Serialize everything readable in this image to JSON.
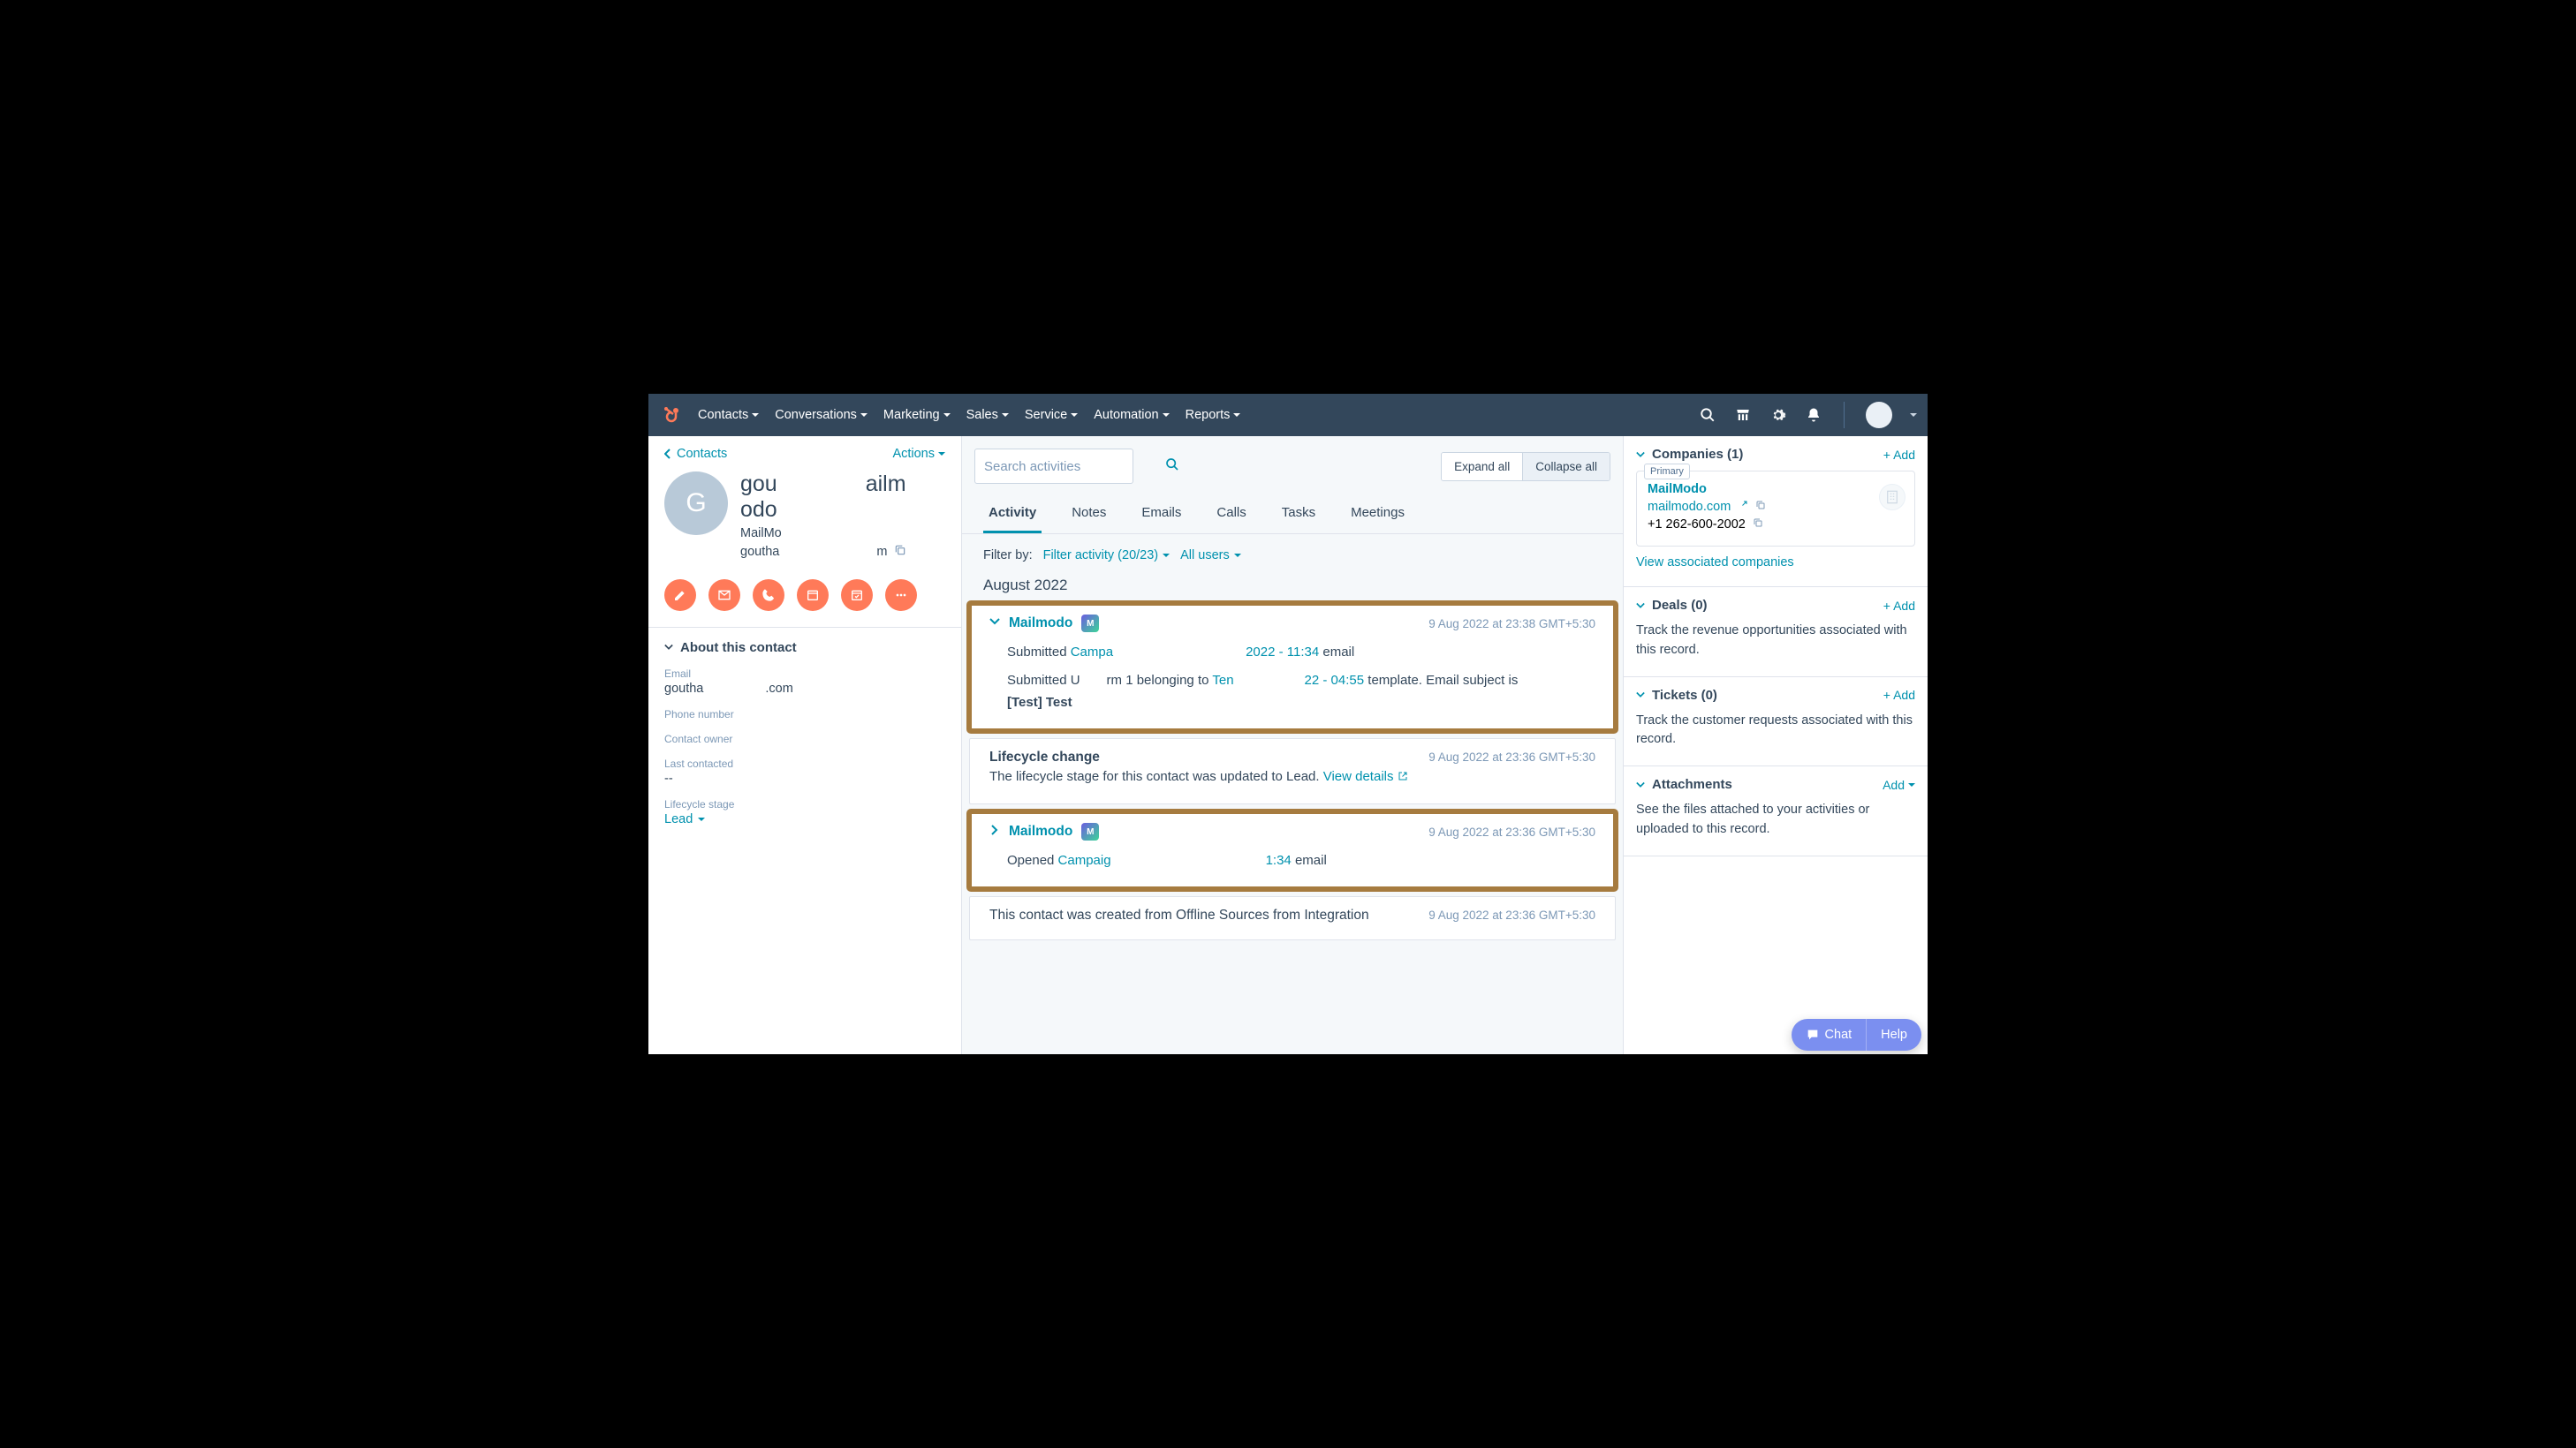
{
  "nav": {
    "items": [
      "Contacts",
      "Conversations",
      "Marketing",
      "Sales",
      "Service",
      "Automation",
      "Reports"
    ]
  },
  "left": {
    "back": "Contacts",
    "actions": "Actions",
    "avatar_letter": "G",
    "name_l1": "gou",
    "name_l2": "ailm",
    "name_l3": "odo",
    "company": "MailMo",
    "email_short_l": "goutha",
    "email_short_r": "m",
    "about_title": "About this contact",
    "fields": {
      "email_label": "Email",
      "email_value_l": "goutha",
      "email_value_r": ".com",
      "phone_label": "Phone number",
      "phone_value": "",
      "owner_label": "Contact owner",
      "owner_value": "",
      "last_label": "Last contacted",
      "last_value": "--",
      "stage_label": "Lifecycle stage",
      "stage_value": "Lead"
    }
  },
  "center": {
    "search_placeholder": "Search activities",
    "expand": "Expand all",
    "collapse": "Collapse all",
    "tabs": [
      "Activity",
      "Notes",
      "Emails",
      "Calls",
      "Tasks",
      "Meetings"
    ],
    "filter_by": "Filter by:",
    "filter_activity": "Filter activity (20/23)",
    "filter_users": "All users",
    "month": "August 2022",
    "card1": {
      "source": "Mailmodo",
      "date": "9 Aug 2022 at 23:38 GMT+5:30",
      "line1_a": "Submitted ",
      "line1_link": "Campa",
      "line1_mid": "2022 - 11:34",
      "line1_end": " email",
      "line2_a": "Submitted U",
      "line2_b": "rm 1 belonging to ",
      "line2_link": "Ten",
      "line2_mid": "22 - 04:55",
      "line2_c": " template. Email subject is ",
      "line2_bold": "[Test] Test"
    },
    "card2": {
      "title": "Lifecycle change",
      "date": "9 Aug 2022 at 23:36 GMT+5:30",
      "body": "The lifecycle stage for this contact was updated to Lead. ",
      "view": "View details"
    },
    "card3": {
      "source": "Mailmodo",
      "date": "9 Aug 2022 at 23:36 GMT+5:30",
      "line1_a": "Opened ",
      "line1_link": "Campaig",
      "line1_mid": "1:34",
      "line1_end": " email"
    },
    "card4": {
      "body": "This contact was created from Offline Sources from Integration",
      "date": "9 Aug 2022 at 23:36 GMT+5:30"
    }
  },
  "right": {
    "companies_title": "Companies (1)",
    "add": "+ Add",
    "primary": "Primary",
    "company_name": "MailModo",
    "company_domain": "mailmodo.com",
    "company_phone": "+1 262-600-2002",
    "view_assoc": "View associated companies",
    "deals_title": "Deals (0)",
    "deals_desc": "Track the revenue opportunities associated with this record.",
    "tickets_title": "Tickets (0)",
    "tickets_desc": "Track the customer requests associated with this record.",
    "attach_title": "Attachments",
    "attach_add": "Add",
    "attach_desc": "See the files attached to your activities or uploaded to this record."
  },
  "chat": {
    "chat": "Chat",
    "help": "Help"
  }
}
